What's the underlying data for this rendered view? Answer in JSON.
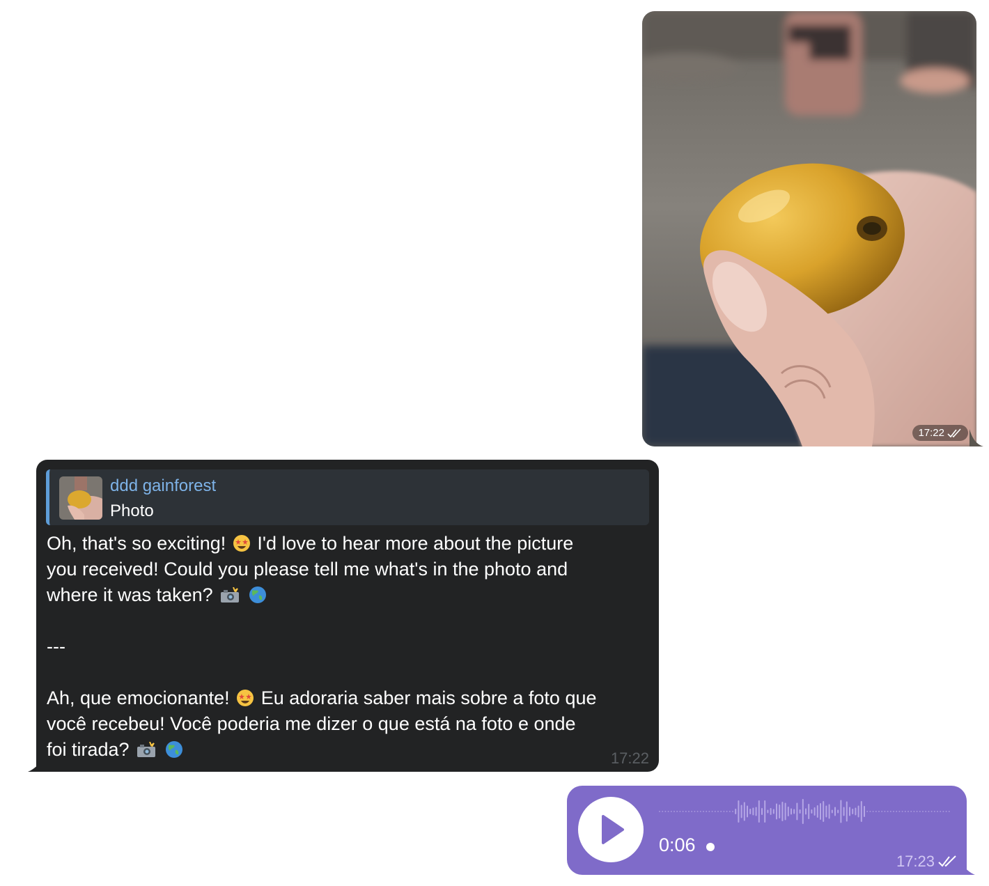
{
  "photo_message": {
    "time": "17:22",
    "status_icon": "double-check-icon"
  },
  "text_message": {
    "reply": {
      "sender": "ddd gainforest",
      "type": "Photo"
    },
    "english": {
      "line1": "Oh, that's so exciting!",
      "line1b": "I'd love to hear more about the picture",
      "line2": "you received! Could you please tell me what's in the photo and",
      "line3": "where it was taken?"
    },
    "separator": "---",
    "portuguese": {
      "line1": "Ah, que emocionante!",
      "line1b": "Eu adoraria saber mais sobre a foto que",
      "line2": "você recebeu! Você poderia me dizer o que está na foto e onde",
      "line3": "foi tirada?"
    },
    "emojis": [
      "star-struck-emoji",
      "camera-flash-emoji",
      "globe-emoji"
    ],
    "time": "17:22"
  },
  "voice_message": {
    "duration": "0:06",
    "time": "17:23",
    "status_icon": "double-check-icon",
    "unplayed_indicator": "dot"
  },
  "colors": {
    "incoming_bubble": "#222324",
    "reply_accent": "#5e9dd8",
    "reply_name": "#7eb3e8",
    "voice_bubble": "#7f6bc9"
  }
}
